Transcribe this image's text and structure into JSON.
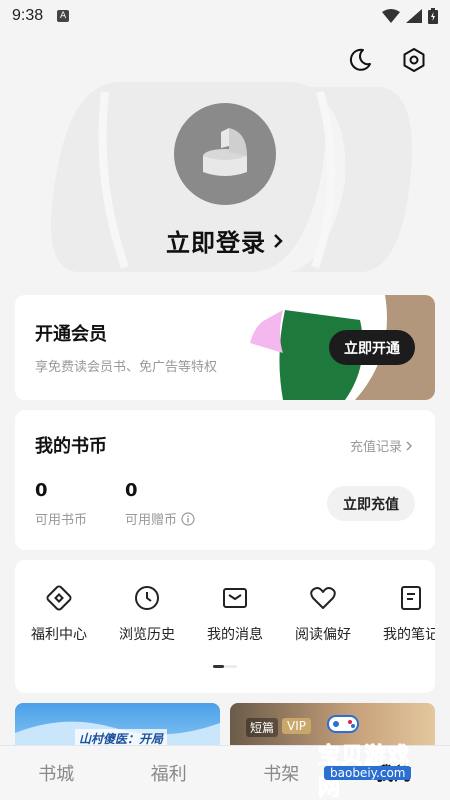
{
  "status_bar": {
    "time": "9:38",
    "notif_glyph": "A"
  },
  "header_icons": [
    {
      "name": "moon-icon"
    },
    {
      "name": "settings-hexagon-icon"
    }
  ],
  "profile": {
    "login_label": "立即登录",
    "arrow": "›"
  },
  "vip": {
    "title": "开通会员",
    "description": "享免费读会员书、免广告等特权",
    "button_label": "立即开通"
  },
  "coins": {
    "title": "我的书币",
    "record_label": "充值记录",
    "stats": [
      {
        "value": "0",
        "label": "可用书币"
      },
      {
        "value": "0",
        "label": "可用赠币"
      }
    ],
    "button_label": "立即充值"
  },
  "menu": {
    "items": [
      {
        "label": "福利中心",
        "icon": "welfare-icon"
      },
      {
        "label": "浏览历史",
        "icon": "clock-icon"
      },
      {
        "label": "我的消息",
        "icon": "message-icon"
      },
      {
        "label": "阅读偏好",
        "icon": "heart-icon"
      },
      {
        "label": "我的笔记",
        "icon": "note-icon"
      }
    ]
  },
  "banners": {
    "left_text": "山村傻医：开局",
    "right_badges": [
      "短篇",
      "VIP"
    ]
  },
  "watermark": {
    "title": "宝贝游戏网",
    "url": "baobeiy.com"
  },
  "bottom_nav": {
    "items": [
      {
        "label": "书城",
        "active": false
      },
      {
        "label": "福利",
        "active": false
      },
      {
        "label": "书架",
        "active": false
      },
      {
        "label": "我的",
        "active": true
      }
    ]
  }
}
